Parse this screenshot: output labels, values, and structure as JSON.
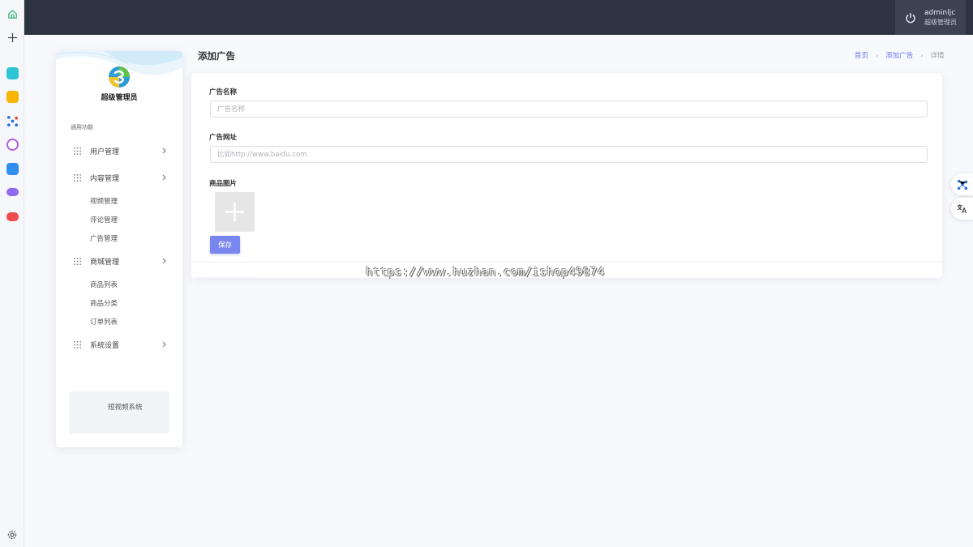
{
  "header": {
    "user_name": "adminljc",
    "user_role": "超级管理员"
  },
  "sidebar": {
    "admin_name": "超级管理员",
    "section_label": "通用功能",
    "items": [
      {
        "label": "用户管理",
        "children": []
      },
      {
        "label": "内容管理",
        "children": [
          "视频管理",
          "评论管理",
          "广告管理"
        ]
      },
      {
        "label": "商城管理",
        "children": [
          "商品列表",
          "商品分类",
          "订单列表"
        ]
      },
      {
        "label": "系统设置",
        "children": []
      }
    ],
    "footer_text": "短视频系统"
  },
  "page": {
    "title": "添加广告",
    "breadcrumb": [
      "首页",
      "添加广告",
      "详情"
    ]
  },
  "form": {
    "name_label": "广告名称",
    "name_placeholder": "广告名称",
    "url_label": "广告网址",
    "url_placeholder": "比如http://www.baidu.com",
    "image_label": "商品图片",
    "save_label": "保存"
  },
  "watermark": "https://www.huzhan.com/ishop49874",
  "colors": {
    "topbar": "#2d3441",
    "accent": "#7a86f0",
    "link": "#6b7ae8"
  }
}
